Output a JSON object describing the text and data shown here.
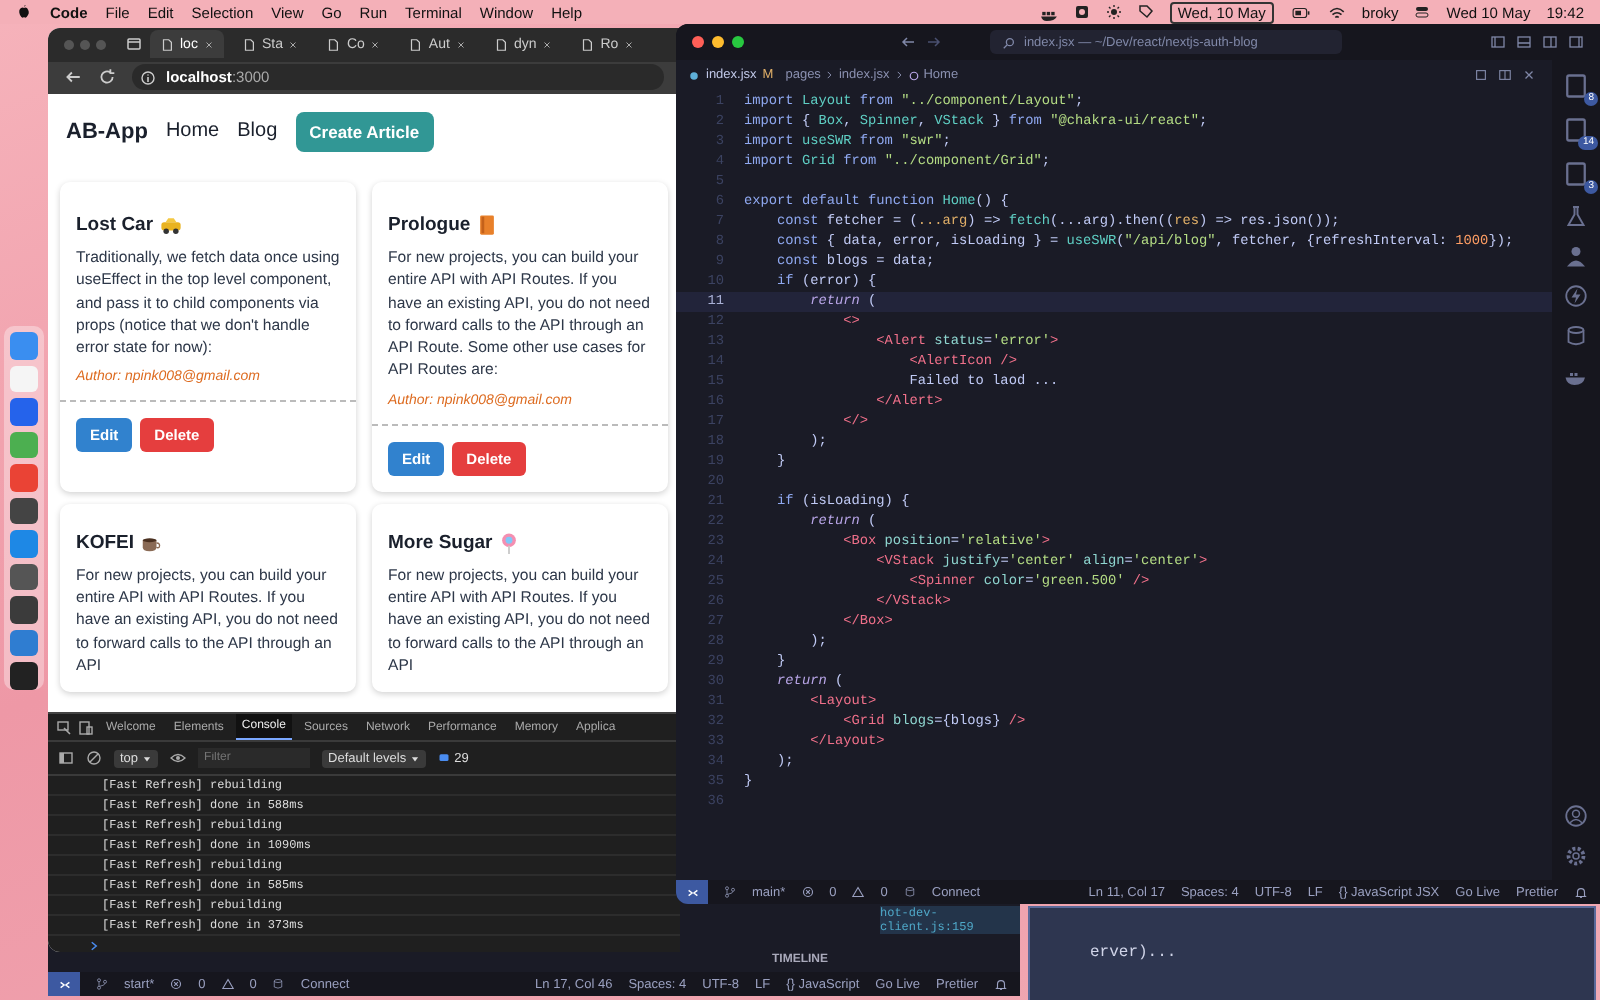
{
  "menu_bar": {
    "app": "Code",
    "menus": [
      "File",
      "Edit",
      "Selection",
      "View",
      "Go",
      "Run",
      "Terminal",
      "Window",
      "Help"
    ],
    "date_box": "Wed, 10 May",
    "user": "broky",
    "date": "Wed 10 May",
    "time": "19:42"
  },
  "browser": {
    "tabs": [
      {
        "label": "loc",
        "selected": true
      },
      {
        "label": "Sta",
        "selected": false
      },
      {
        "label": "Co",
        "selected": false
      },
      {
        "label": "Aut",
        "selected": false
      },
      {
        "label": "dyn",
        "selected": false
      },
      {
        "label": "Ro",
        "selected": false
      }
    ],
    "address": "**localhost**:3000",
    "page": {
      "brand": "AB-App",
      "nav": [
        "Home",
        "Blog"
      ],
      "create_button": "Create Article",
      "posts": [
        {
          "title": "Lost Car",
          "body": "Traditionally, we fetch data once using useEffect in the top level component, and pass it to child components via props (notice that we don't handle error state for now):",
          "author": "Author: npink008@gmail.com",
          "actions": [
            {
              "label": "Edit",
              "kind": "edit"
            },
            {
              "label": "Delete",
              "kind": "delete"
            }
          ]
        },
        {
          "title": "Prologue",
          "body": "For new projects, you can build your entire API with API Routes. If you have an existing API, you do not need to forward calls to the API through an API Route. Some other use cases for API Routes are:",
          "author": "Author: npink008@gmail.com",
          "actions": [
            {
              "label": "Edit",
              "kind": "edit"
            },
            {
              "label": "Delete",
              "kind": "delete"
            }
          ]
        },
        {
          "title": "KOFEI",
          "body": "For new projects, you can build your entire API with API Routes. If you have an existing API, you do not need to forward calls to the API through an API"
        },
        {
          "title": "More Sugar",
          "body": "For new projects, you can build your entire API with API Routes. If you have an existing API, you do not need to forward calls to the API through an API"
        }
      ]
    },
    "devtools": {
      "tabs": [
        {
          "label": "Welcome",
          "selected": false
        },
        {
          "label": "Elements",
          "selected": false
        },
        {
          "label": "Console",
          "selected": true
        },
        {
          "label": "Sources",
          "selected": false
        },
        {
          "label": "Network",
          "selected": false
        },
        {
          "label": "Performance",
          "selected": false
        },
        {
          "label": "Memory",
          "selected": false
        },
        {
          "label": "Applica",
          "selected": false
        }
      ],
      "context": "top",
      "filter_placeholder": "Filter",
      "levels": "Default levels",
      "issues": "29",
      "console_lines": [
        "[Fast Refresh] rebuilding",
        "[Fast Refresh] done in 588ms",
        "[Fast Refresh] rebuilding",
        "[Fast Refresh] done in 1090ms",
        "[Fast Refresh] rebuilding",
        "[Fast Refresh] done in 585ms",
        "[Fast Refresh] rebuilding",
        "[Fast Refresh] done in 373ms"
      ]
    }
  },
  "back_editor": {
    "link": "hot-dev-client.js:159",
    "section": "TIMELINE",
    "status_bar": {
      "branch": "start*",
      "errors": "0",
      "warnings": "0",
      "connect": "Connect",
      "items": [
        "Ln 17, Col 46",
        "Spaces: 4",
        "UTF-8",
        "LF",
        "{} JavaScript",
        "Go Live",
        "Prettier"
      ]
    }
  },
  "terminal": {
    "text": "erver)..."
  },
  "editor": {
    "title": "index.jsx — ~/Dev/react/nextjs-auth-blog",
    "tab": {
      "label": "index.jsx",
      "status": "M"
    },
    "breadcrumb": [
      "pages",
      "index.jsx",
      "Home"
    ],
    "lines": [
      {
        "number": "1",
        "current": false,
        "segments": [
          {
            "kind": "keyword",
            "text": "import "
          },
          {
            "kind": "name",
            "text": "Layout "
          },
          {
            "kind": "keyword",
            "text": "from "
          },
          {
            "kind": "string",
            "text": "\"../component/Layout\""
          },
          {
            "kind": "plain",
            "text": ";"
          }
        ]
      },
      {
        "number": "2",
        "current": false,
        "segments": [
          {
            "kind": "keyword",
            "text": "import "
          },
          {
            "kind": "plain",
            "text": "{ "
          },
          {
            "kind": "name",
            "text": "Box"
          },
          {
            "kind": "plain",
            "text": ", "
          },
          {
            "kind": "name",
            "text": "Spinner"
          },
          {
            "kind": "plain",
            "text": ", "
          },
          {
            "kind": "name",
            "text": "VStack"
          },
          {
            "kind": "plain",
            "text": " } "
          },
          {
            "kind": "keyword",
            "text": "from "
          },
          {
            "kind": "string",
            "text": "\"@chakra-ui/react\""
          },
          {
            "kind": "plain",
            "text": ";"
          }
        ]
      },
      {
        "number": "3",
        "current": false,
        "segments": [
          {
            "kind": "keyword",
            "text": "import "
          },
          {
            "kind": "name",
            "text": "useSWR "
          },
          {
            "kind": "keyword",
            "text": "from "
          },
          {
            "kind": "string",
            "text": "\"swr\""
          },
          {
            "kind": "plain",
            "text": ";"
          }
        ]
      },
      {
        "number": "4",
        "current": false,
        "segments": [
          {
            "kind": "keyword",
            "text": "import "
          },
          {
            "kind": "name",
            "text": "Grid "
          },
          {
            "kind": "keyword",
            "text": "from "
          },
          {
            "kind": "string",
            "text": "\"../component/Grid\""
          },
          {
            "kind": "plain",
            "text": ";"
          }
        ]
      },
      {
        "number": "5",
        "current": false
      },
      {
        "number": "6",
        "current": false,
        "segments": [
          {
            "kind": "keyword",
            "text": "export default function "
          },
          {
            "kind": "name",
            "text": "Home"
          },
          {
            "kind": "plain",
            "text": "() {"
          }
        ]
      },
      {
        "number": "7",
        "current": false,
        "segments": [
          {
            "kind": "keyword",
            "text": "    const "
          },
          {
            "kind": "plain",
            "text": "fetcher = ("
          },
          {
            "kind": "param",
            "text": "...arg"
          },
          {
            "kind": "plain",
            "text": ") => "
          },
          {
            "kind": "name",
            "text": "fetch"
          },
          {
            "kind": "plain",
            "text": "(...arg).then(("
          },
          {
            "kind": "param",
            "text": "res"
          },
          {
            "kind": "plain",
            "text": ") => res.json());"
          }
        ]
      },
      {
        "number": "8",
        "current": false,
        "segments": [
          {
            "kind": "keyword",
            "text": "    const "
          },
          {
            "kind": "plain",
            "text": "{ data, error, isLoading } = "
          },
          {
            "kind": "name",
            "text": "useSWR"
          },
          {
            "kind": "plain",
            "text": "("
          },
          {
            "kind": "string",
            "text": "\"/api/blog\""
          },
          {
            "kind": "plain",
            "text": ", fetcher, {refreshInterval: "
          },
          {
            "kind": "number",
            "text": "1000"
          },
          {
            "kind": "plain",
            "text": "});"
          }
        ]
      },
      {
        "number": "9",
        "current": false,
        "segments": [
          {
            "kind": "keyword",
            "text": "    const "
          },
          {
            "kind": "plain",
            "text": "blogs = data;"
          }
        ]
      },
      {
        "number": "10",
        "current": false,
        "segments": [
          {
            "kind": "keyword",
            "text": "    if "
          },
          {
            "kind": "plain",
            "text": "(error) {"
          }
        ]
      },
      {
        "number": "11",
        "current": true,
        "segments": [
          {
            "kind": "return",
            "text": "        return "
          },
          {
            "kind": "plain",
            "text": "("
          }
        ]
      },
      {
        "number": "12",
        "current": false,
        "segments": [
          {
            "kind": "tag",
            "text": "            <>"
          }
        ]
      },
      {
        "number": "13",
        "current": false,
        "segments": [
          {
            "kind": "tag",
            "text": "                <Alert "
          },
          {
            "kind": "attr",
            "text": "status"
          },
          {
            "kind": "plain",
            "text": "="
          },
          {
            "kind": "string",
            "text": "'error'"
          },
          {
            "kind": "tag",
            "text": ">"
          }
        ]
      },
      {
        "number": "14",
        "current": false,
        "segments": [
          {
            "kind": "tag",
            "text": "                    <AlertIcon />"
          }
        ]
      },
      {
        "number": "15",
        "current": false,
        "segments": [
          {
            "kind": "plain",
            "text": "                    Failed to laod ..."
          }
        ]
      },
      {
        "number": "16",
        "current": false,
        "segments": [
          {
            "kind": "tag",
            "text": "                </Alert>"
          }
        ]
      },
      {
        "number": "17",
        "current": false,
        "segments": [
          {
            "kind": "tag",
            "text": "            </>"
          }
        ]
      },
      {
        "number": "18",
        "current": false,
        "segments": [
          {
            "kind": "plain",
            "text": "        );"
          }
        ]
      },
      {
        "number": "19",
        "current": false,
        "segments": [
          {
            "kind": "plain",
            "text": "    }"
          }
        ]
      },
      {
        "number": "20",
        "current": false
      },
      {
        "number": "21",
        "current": false,
        "segments": [
          {
            "kind": "keyword",
            "text": "    if "
          },
          {
            "kind": "plain",
            "text": "(isLoading) {"
          }
        ]
      },
      {
        "number": "22",
        "current": false,
        "segments": [
          {
            "kind": "return",
            "text": "        return "
          },
          {
            "kind": "plain",
            "text": "("
          }
        ]
      },
      {
        "number": "23",
        "current": false,
        "segments": [
          {
            "kind": "tag",
            "text": "            <Box "
          },
          {
            "kind": "attr",
            "text": "position"
          },
          {
            "kind": "plain",
            "text": "="
          },
          {
            "kind": "string",
            "text": "'relative'"
          },
          {
            "kind": "tag",
            "text": ">"
          }
        ]
      },
      {
        "number": "24",
        "current": false,
        "segments": [
          {
            "kind": "tag",
            "text": "                <VStack "
          },
          {
            "kind": "attr",
            "text": "justify"
          },
          {
            "kind": "plain",
            "text": "="
          },
          {
            "kind": "string",
            "text": "'center'"
          },
          {
            "kind": "attr",
            "text": " align"
          },
          {
            "kind": "plain",
            "text": "="
          },
          {
            "kind": "string",
            "text": "'center'"
          },
          {
            "kind": "tag",
            "text": ">"
          }
        ]
      },
      {
        "number": "25",
        "current": false,
        "segments": [
          {
            "kind": "tag",
            "text": "                    <Spinner "
          },
          {
            "kind": "attr",
            "text": "color"
          },
          {
            "kind": "plain",
            "text": "="
          },
          {
            "kind": "string",
            "text": "'green.500'"
          },
          {
            "kind": "tag",
            "text": " />"
          }
        ]
      },
      {
        "number": "26",
        "current": false,
        "segments": [
          {
            "kind": "tag",
            "text": "                </VStack>"
          }
        ]
      },
      {
        "number": "27",
        "current": false,
        "segments": [
          {
            "kind": "tag",
            "text": "            </Box>"
          }
        ]
      },
      {
        "number": "28",
        "current": false,
        "segments": [
          {
            "kind": "plain",
            "text": "        );"
          }
        ]
      },
      {
        "number": "29",
        "current": false,
        "segments": [
          {
            "kind": "plain",
            "text": "    }"
          }
        ]
      },
      {
        "number": "30",
        "current": false,
        "segments": [
          {
            "kind": "return",
            "text": "    return "
          },
          {
            "kind": "plain",
            "text": "("
          }
        ]
      },
      {
        "number": "31",
        "current": false,
        "segments": [
          {
            "kind": "tag",
            "text": "        <Layout>"
          }
        ]
      },
      {
        "number": "32",
        "current": false,
        "segments": [
          {
            "kind": "tag",
            "text": "            <Grid "
          },
          {
            "kind": "attr",
            "text": "blogs"
          },
          {
            "kind": "plain",
            "text": "={blogs} "
          },
          {
            "kind": "tag",
            "text": "/>"
          }
        ]
      },
      {
        "number": "33",
        "current": false,
        "segments": [
          {
            "kind": "tag",
            "text": "        </Layout>"
          }
        ]
      },
      {
        "number": "34",
        "current": false,
        "segments": [
          {
            "kind": "plain",
            "text": "    );"
          }
        ]
      },
      {
        "number": "35",
        "current": false,
        "segments": [
          {
            "kind": "plain",
            "text": "}"
          }
        ]
      },
      {
        "number": "36",
        "current": false
      }
    ],
    "activity_badges": [
      "8",
      "14",
      "3"
    ],
    "status_bar": {
      "branch": "main*",
      "errors": "0",
      "warnings": "0",
      "connect": "Connect",
      "items": [
        "Ln 11, Col 17",
        "Spaces: 4",
        "UTF-8",
        "LF",
        "{} JavaScript JSX",
        "Go Live",
        "Prettier"
      ]
    }
  }
}
